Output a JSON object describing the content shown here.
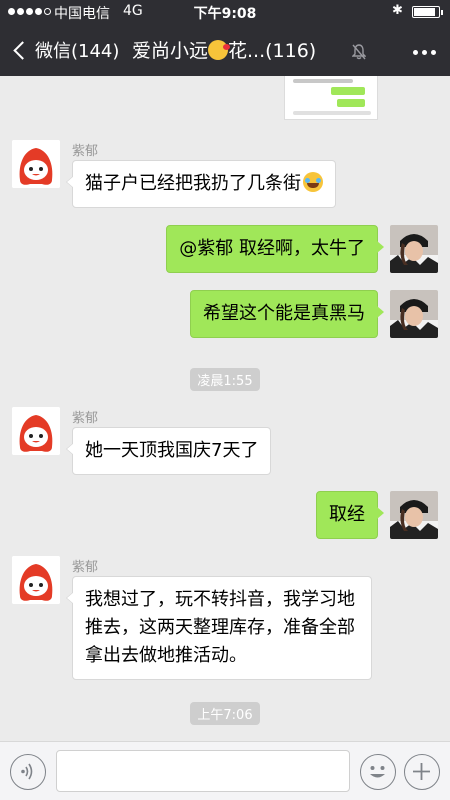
{
  "status_bar": {
    "carrier": "中国电信",
    "network": "4G",
    "time": "下午9:08",
    "signal_level": 4,
    "battery_level": 0.8
  },
  "nav": {
    "back_label": "微信(144)",
    "title": "爱尚小远",
    "title_suffix": "花...(116)",
    "muted": true
  },
  "messages": [
    {
      "type": "image",
      "from": "me"
    },
    {
      "type": "text",
      "from": "other",
      "sender": "紫郁",
      "text": "猫子户已经把我扔了几条街",
      "emoji": "cry-laugh-emoji"
    },
    {
      "type": "text",
      "from": "me",
      "text": "@紫郁 取经啊，太牛了"
    },
    {
      "type": "text",
      "from": "me",
      "text": "希望这个能是真黑马"
    },
    {
      "type": "time",
      "text": "凌晨1:55"
    },
    {
      "type": "text",
      "from": "other",
      "sender": "紫郁",
      "text": "她一天顶我国庆7天了"
    },
    {
      "type": "text",
      "from": "me",
      "text": "取经"
    },
    {
      "type": "text",
      "from": "other",
      "sender": "紫郁",
      "text": "我想过了，玩不转抖音，我学习地推去，这两天整理库存，准备全部拿出去做地推活动。"
    },
    {
      "type": "time",
      "text": "上午7:06"
    }
  ],
  "input": {
    "placeholder": ""
  },
  "colors": {
    "header_bg": "#2e2e33",
    "chat_bg": "#ebebeb",
    "my_bubble": "#a0e759",
    "other_bubble": "#ffffff",
    "avatar_red": "#e43b26"
  },
  "icons": {
    "back": "chevron-left-icon",
    "mute": "bell-muted-icon",
    "more": "more-icon",
    "voice": "voice-icon",
    "emoji": "emoji-icon",
    "plus": "plus-icon"
  }
}
